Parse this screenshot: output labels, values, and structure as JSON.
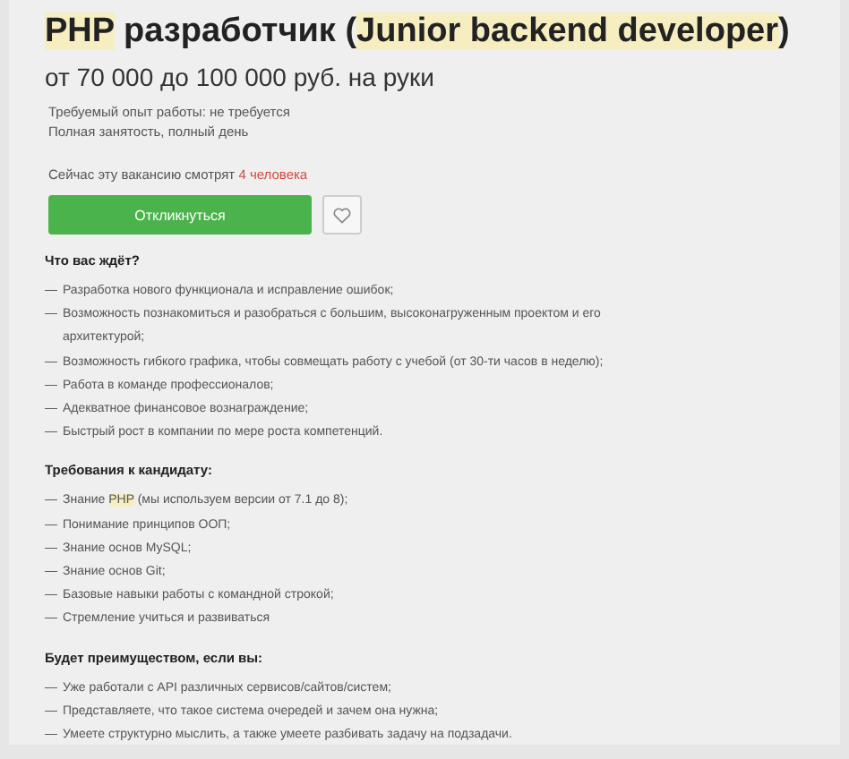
{
  "title": [
    {
      "text": "PHP",
      "highlighted": true
    },
    {
      "text": " разработчик (",
      "highlighted": false
    },
    {
      "text": "Junior backend developer",
      "highlighted": true
    },
    {
      "text": ")",
      "highlighted": false
    }
  ],
  "salary": "от 70 000 до 100 000 руб. на руки",
  "details": [
    "Требуемый опыт работы: не требуется",
    "Полная занятость, полный день"
  ],
  "viewers": {
    "text": "Сейчас эту вакансию смотрят ",
    "count": "4 человека"
  },
  "apply_button": "Откликнуться",
  "favorite": {
    "selected": false
  },
  "sections": [
    {
      "heading": "Что вас ждёт?",
      "items": [
        {
          "marker": "—",
          "parts": [
            {
              "text": "Разработка нового функционала и исправление ошибок;",
              "highlighted": false
            }
          ]
        },
        {
          "marker": "—",
          "parts": [
            {
              "text": "Возможность познакомиться и разобраться с большим, высоконагруженным проектом и его архитектурой;",
              "highlighted": false
            }
          ]
        },
        {
          "marker": "—",
          "parts": [
            {
              "text": "Возможность гибкого графика, чтобы совмещать работу с учебой (от 30-ти часов в неделю);",
              "highlighted": false
            }
          ]
        },
        {
          "marker": "—",
          "parts": [
            {
              "text": "Работа в команде профессионалов;",
              "highlighted": false
            }
          ]
        },
        {
          "marker": "—",
          "parts": [
            {
              "text": "Адекватное финансовое вознаграждение;",
              "highlighted": false
            }
          ]
        },
        {
          "marker": "—",
          "parts": [
            {
              "text": "Быстрый рост в компании по мере роста компетенций.",
              "highlighted": false
            }
          ]
        }
      ]
    },
    {
      "heading": "Требования к кандидату:",
      "items": [
        {
          "marker": "—",
          "parts": [
            {
              "text": "Знание ",
              "highlighted": false
            },
            {
              "text": "PHP",
              "highlighted": true
            },
            {
              "text": " (мы используем версии от 7.1 до 8);",
              "highlighted": false
            }
          ]
        },
        {
          "marker": "—",
          "parts": [
            {
              "text": "Понимание принципов ООП;",
              "highlighted": false
            }
          ]
        },
        {
          "marker": "—",
          "parts": [
            {
              "text": "Знание основ MySQL;",
              "highlighted": false
            }
          ]
        },
        {
          "marker": "—",
          "parts": [
            {
              "text": "Знание основ Git;",
              "highlighted": false
            }
          ]
        },
        {
          "marker": "—",
          "parts": [
            {
              "text": "Базовые навыки работы с командной строкой;",
              "highlighted": false
            }
          ]
        },
        {
          "marker": "—",
          "parts": [
            {
              "text": "Стремление учиться и развиваться",
              "highlighted": false
            }
          ]
        }
      ]
    },
    {
      "heading": "Будет преимуществом, если вы:",
      "items": [
        {
          "marker": "—",
          "parts": [
            {
              "text": "Уже работали с API различных сервисов/сайтов/систем;",
              "highlighted": false
            }
          ]
        },
        {
          "marker": "—",
          "parts": [
            {
              "text": "Представляете, что такое система очередей и зачем она нужна;",
              "highlighted": false
            }
          ]
        },
        {
          "marker": "—",
          "parts": [
            {
              "text": "Умеете структурно мыслить, а также умеете разбивать задачу на подзадачи.",
              "highlighted": false
            }
          ]
        }
      ]
    }
  ]
}
